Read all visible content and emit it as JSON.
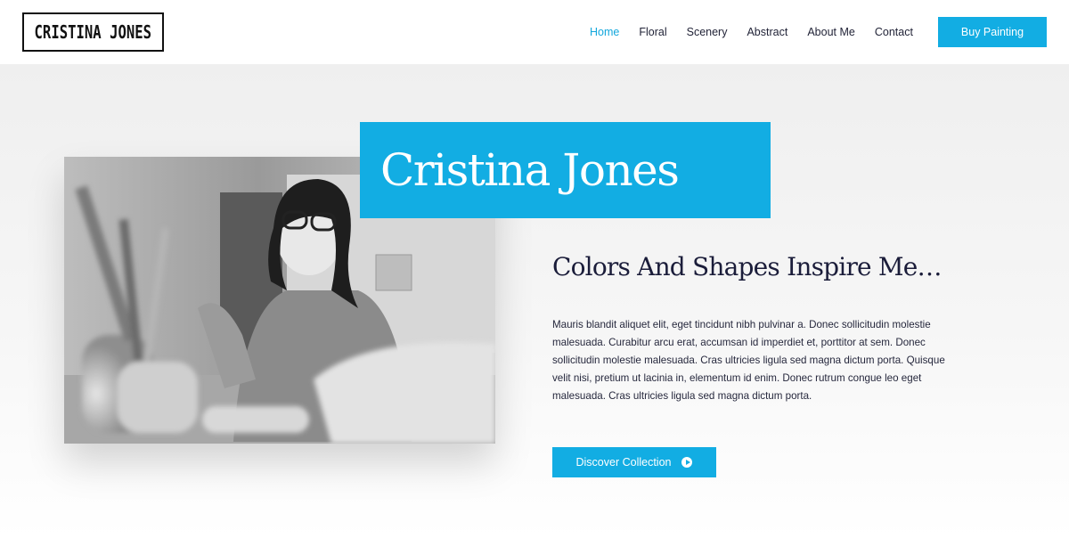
{
  "header": {
    "logo_text": "CRISTINA JONES",
    "nav": [
      {
        "label": "Home",
        "active": true
      },
      {
        "label": "Floral",
        "active": false
      },
      {
        "label": "Scenery",
        "active": false
      },
      {
        "label": "Abstract",
        "active": false
      },
      {
        "label": "About Me",
        "active": false
      },
      {
        "label": "Contact",
        "active": false
      }
    ],
    "cta_label": "Buy Painting"
  },
  "hero": {
    "title": "Cristina Jones",
    "subtitle": "Colors And Shapes Inspire Me…",
    "body": "Mauris blandit aliquet elit, eget tincidunt nibh pulvinar a. Donec sollicitudin molestie malesuada. Curabitur arcu erat, accumsan id imperdiet et, porttitor at sem. Donec sollicitudin molestie malesuada. Cras ultricies ligula sed magna dictum porta. Quisque velit nisi, pretium ut lacinia in, elementum id enim. Donec rutrum congue leo eget malesuada. Cras ultricies ligula sed magna dictum porta.",
    "button_label": "Discover Collection",
    "button_icon": "play-circle-icon",
    "photo": "black-and-white-photo-of-artist-painting"
  },
  "colors": {
    "accent": "#12ade3",
    "text_dark": "#1b1d3a"
  }
}
